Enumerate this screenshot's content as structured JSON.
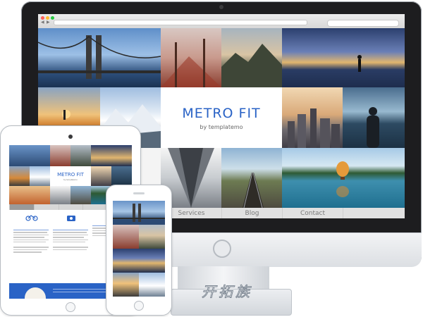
{
  "site": {
    "title": "METRO FIT",
    "subtitle": "by templatemo",
    "menu": [
      "Services",
      "Blog",
      "Contact"
    ]
  },
  "tablet": {
    "title": "METRO FIT",
    "subtitle": "by templatemo"
  },
  "watermark": "开拓族",
  "colors": {
    "accent": "#2a63c6",
    "monitor_bezel": "#1d1d1f",
    "menu_bg": "#e1e1e1"
  },
  "icons": [
    "bicycle-icon",
    "camera-icon"
  ]
}
